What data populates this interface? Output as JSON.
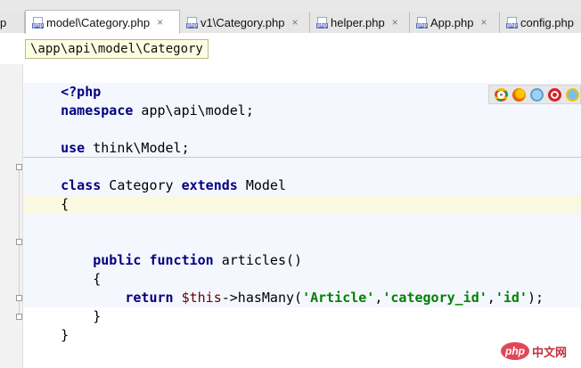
{
  "tabs": [
    {
      "label": "p",
      "icon": "",
      "closable": false
    },
    {
      "label": "model\\Category.php",
      "icon": "php-file-icon",
      "closable": true,
      "active": true
    },
    {
      "label": "v1\\Category.php",
      "icon": "php-file-icon",
      "closable": true
    },
    {
      "label": "helper.php",
      "icon": "php-file-icon",
      "closable": true
    },
    {
      "label": "App.php",
      "icon": "php-file-icon",
      "closable": true
    },
    {
      "label": "config.php",
      "icon": "php-file-icon",
      "closable": false
    }
  ],
  "icon_text": {
    "php": "php",
    "close": "×"
  },
  "tooltip": "\\app\\api\\model\\Category",
  "code": {
    "l1": "<?php",
    "l2_kw": "namespace",
    "l2_rest": " app\\api\\model;",
    "l4_kw": "use",
    "l4_rest": " think\\Model;",
    "l6_kw1": "class",
    "l6_a": " Category ",
    "l6_kw2": "extends",
    "l6_b": " Model",
    "l7": "{",
    "l10_ind": "    ",
    "l10_kw1": "public",
    "l10_sp": " ",
    "l10_kw2": "function",
    "l10_rest": " articles()",
    "l11": "    {",
    "l12_ind": "        ",
    "l12_kw": "return",
    "l12_sp": " ",
    "l12_var": "$this",
    "l12_call": "->hasMany(",
    "l12_s1": "'Article'",
    "l12_c1": ",",
    "l12_s2": "'category_id'",
    "l12_c2": ",",
    "l12_s3": "'id'",
    "l12_end": ");",
    "l13": "    }",
    "l14": "}"
  },
  "browser_icons": [
    "chrome-icon",
    "firefox-icon",
    "safari-icon",
    "opera-icon",
    "ie-icon"
  ],
  "watermark": {
    "logo_text": "php",
    "text": "中文网"
  },
  "colors": {
    "keyword": "#000080",
    "string": "#008000",
    "variable": "#660000",
    "caret_line": "#fbf8e2"
  }
}
